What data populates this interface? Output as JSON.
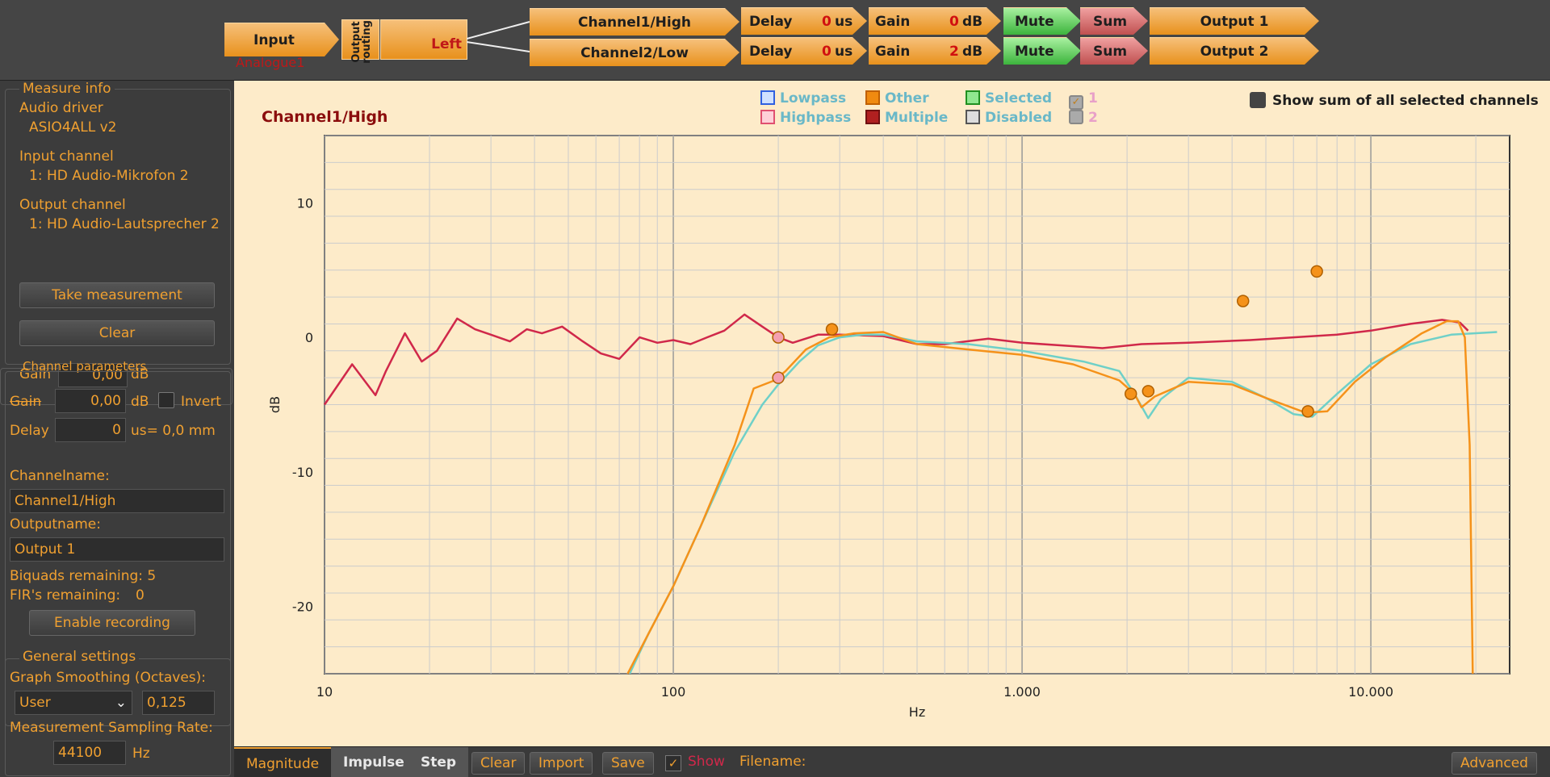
{
  "routing": {
    "input_label": "Input",
    "input_sub": "Analogue1",
    "output_routing_label": "Output routing",
    "left_label": "Left",
    "channels": [
      {
        "name": "Channel1/High",
        "delay_label": "Delay",
        "delay_value": "0",
        "delay_unit": "us",
        "gain_label": "Gain",
        "gain_value": "0",
        "gain_unit": "dB",
        "mute_label": "Mute",
        "sum_label": "Sum",
        "output_label": "Output 1"
      },
      {
        "name": "Channel2/Low",
        "delay_label": "Delay",
        "delay_value": "0",
        "delay_unit": "us",
        "gain_label": "Gain",
        "gain_value": "2",
        "gain_unit": "dB",
        "mute_label": "Mute",
        "sum_label": "Sum",
        "output_label": "Output 2"
      }
    ]
  },
  "measure_info": {
    "title": "Measure info",
    "audio_driver_label": "Audio driver",
    "audio_driver_value": "ASIO4ALL v2",
    "input_channel_label": "Input channel",
    "input_channel_value": "1: HD Audio-Mikrofon 2",
    "output_channel_label": "Output channel",
    "output_channel_value": "1: HD Audio-Lautsprecher 2",
    "take_measurement": "Take measurement",
    "clear": "Clear"
  },
  "channel_params": {
    "title": "Channel parameters",
    "gain_label_1": "Gain",
    "gain_value_1": "0,00",
    "gain_unit_1": "dB",
    "gain_label": "Gain",
    "gain_value": "0,00",
    "gain_unit": "dB",
    "invert_label": "Invert",
    "delay_label": "Delay",
    "delay_value": "0",
    "delay_unit": "us= 0,0 mm",
    "channelname_label": "Channelname:",
    "channelname_value": "Channel1/High",
    "outputname_label": "Outputname:",
    "outputname_value": "Output 1",
    "biquads_label": "Biquads remaining: 5",
    "firs_label": "FIR's remaining:",
    "firs_value": "0",
    "enable_recording": "Enable recording"
  },
  "general_settings": {
    "title": "General settings",
    "smoothing_label": "Graph Smoothing (Octaves):",
    "smoothing_mode": "User",
    "smoothing_value": "0,125",
    "sampling_label": "Measurement Sampling Rate:",
    "sampling_value": "44100",
    "sampling_unit": "Hz"
  },
  "legend": {
    "lowpass": "Lowpass",
    "highpass": "Highpass",
    "other": "Other",
    "multiple": "Multiple",
    "selected": "Selected",
    "disabled": "Disabled",
    "ch1": "1",
    "ch2": "2",
    "show_sum": "Show sum of all selected channels",
    "colors": {
      "lowpass": "#3060e0",
      "highpass": "#e05070",
      "other": "#f08a10",
      "multiple": "#b02020",
      "selected": "#40c040",
      "disabled": "#888888"
    }
  },
  "chart_data": {
    "type": "line",
    "title": "Channel1/High",
    "xlabel": "Hz",
    "ylabel": "dB",
    "xscale": "log",
    "xlim": [
      10,
      25000
    ],
    "ylim": [
      -25,
      15
    ],
    "x_ticks": [
      {
        "v": 10,
        "label": "10"
      },
      {
        "v": 100,
        "label": "100"
      },
      {
        "v": 1000,
        "label": "1.000"
      },
      {
        "v": 10000,
        "label": "10.000"
      }
    ],
    "y_ticks": [
      {
        "v": 10,
        "label": "10"
      },
      {
        "v": 0,
        "label": "0"
      },
      {
        "v": -10,
        "label": "-10"
      },
      {
        "v": -20,
        "label": "-20"
      }
    ],
    "grid": true,
    "series": [
      {
        "color": "#d0284a",
        "points": [
          [
            10,
            -5
          ],
          [
            12,
            -2
          ],
          [
            14,
            -4.3
          ],
          [
            15,
            -2.5
          ],
          [
            17,
            0.3
          ],
          [
            19,
            -1.8
          ],
          [
            21,
            -1
          ],
          [
            24,
            1.4
          ],
          [
            27,
            0.6
          ],
          [
            30,
            0.2
          ],
          [
            34,
            -0.3
          ],
          [
            38,
            0.6
          ],
          [
            42,
            0.3
          ],
          [
            48,
            0.8
          ],
          [
            55,
            -0.3
          ],
          [
            62,
            -1.2
          ],
          [
            70,
            -1.6
          ],
          [
            80,
            0
          ],
          [
            90,
            -0.4
          ],
          [
            100,
            -0.2
          ],
          [
            112,
            -0.5
          ],
          [
            125,
            0
          ],
          [
            140,
            0.5
          ],
          [
            160,
            1.7
          ],
          [
            180,
            0.8
          ],
          [
            200,
            0
          ],
          [
            220,
            -0.4
          ],
          [
            260,
            0.2
          ],
          [
            300,
            0.2
          ],
          [
            400,
            0.1
          ],
          [
            500,
            -0.5
          ],
          [
            600,
            -0.5
          ],
          [
            800,
            -0.1
          ],
          [
            1000,
            -0.4
          ],
          [
            1300,
            -0.6
          ],
          [
            1700,
            -0.8
          ],
          [
            2200,
            -0.5
          ],
          [
            3000,
            -0.4
          ],
          [
            4500,
            -0.2
          ],
          [
            6000,
            0
          ],
          [
            8000,
            0.2
          ],
          [
            10000,
            0.5
          ],
          [
            13000,
            1
          ],
          [
            16000,
            1.3
          ],
          [
            18000,
            1.1
          ],
          [
            19000,
            0.5
          ]
        ]
      },
      {
        "color": "#6fd0c8",
        "points": [
          [
            75,
            -25
          ],
          [
            85,
            -22
          ],
          [
            100,
            -18.5
          ],
          [
            120,
            -14
          ],
          [
            150,
            -8.5
          ],
          [
            180,
            -5
          ],
          [
            200,
            -3.5
          ],
          [
            230,
            -1.8
          ],
          [
            260,
            -0.6
          ],
          [
            300,
            0
          ],
          [
            350,
            0.2
          ],
          [
            400,
            0.2
          ],
          [
            500,
            -0.3
          ],
          [
            700,
            -0.5
          ],
          [
            1000,
            -1
          ],
          [
            1500,
            -1.8
          ],
          [
            1900,
            -2.5
          ],
          [
            2100,
            -4.2
          ],
          [
            2300,
            -6
          ],
          [
            2500,
            -4.6
          ],
          [
            3000,
            -3
          ],
          [
            4000,
            -3.3
          ],
          [
            5000,
            -4.5
          ],
          [
            6000,
            -5.7
          ],
          [
            6800,
            -5.9
          ],
          [
            8000,
            -4.2
          ],
          [
            10000,
            -2
          ],
          [
            13000,
            -0.5
          ],
          [
            17000,
            0.2
          ],
          [
            23000,
            0.4
          ]
        ]
      },
      {
        "color": "#f5921a",
        "points": [
          [
            74,
            -25
          ],
          [
            85,
            -22
          ],
          [
            100,
            -18.5
          ],
          [
            120,
            -14
          ],
          [
            150,
            -8
          ],
          [
            170,
            -3.8
          ],
          [
            195,
            -3.2
          ],
          [
            210,
            -2.5
          ],
          [
            240,
            -0.9
          ],
          [
            280,
            0
          ],
          [
            330,
            0.3
          ],
          [
            400,
            0.4
          ],
          [
            500,
            -0.5
          ],
          [
            700,
            -0.9
          ],
          [
            1000,
            -1.3
          ],
          [
            1400,
            -2
          ],
          [
            1900,
            -3.2
          ],
          [
            2100,
            -4.2
          ],
          [
            2200,
            -5.2
          ],
          [
            2400,
            -4.4
          ],
          [
            3000,
            -3.3
          ],
          [
            4000,
            -3.5
          ],
          [
            5000,
            -4.5
          ],
          [
            6500,
            -5.6
          ],
          [
            7500,
            -5.5
          ],
          [
            9000,
            -3.3
          ],
          [
            11000,
            -1.5
          ],
          [
            14000,
            0.3
          ],
          [
            16500,
            1.2
          ],
          [
            17800,
            1.2
          ],
          [
            18600,
            0
          ],
          [
            19200,
            -8
          ],
          [
            19600,
            -25
          ]
        ]
      }
    ],
    "markers": [
      {
        "x": 200,
        "y": 0,
        "color": "#f4a0b0"
      },
      {
        "x": 200,
        "y": -3,
        "color": "#f4a0b0"
      },
      {
        "x": 285,
        "y": 0.6,
        "color": "#f5921a"
      },
      {
        "x": 2050,
        "y": -4.2,
        "color": "#f5921a"
      },
      {
        "x": 2300,
        "y": -4,
        "color": "#f5921a"
      },
      {
        "x": 4300,
        "y": 2.7,
        "color": "#f5921a"
      },
      {
        "x": 7000,
        "y": 4.9,
        "color": "#f5921a"
      },
      {
        "x": 6600,
        "y": -5.5,
        "color": "#f5921a"
      }
    ]
  },
  "toolbar": {
    "magnitude": "Magnitude",
    "impulse": "Impulse",
    "step": "Step",
    "clear": "Clear",
    "import": "Import",
    "save": "Save",
    "show": "Show",
    "filename": "Filename:",
    "advanced": "Advanced"
  }
}
